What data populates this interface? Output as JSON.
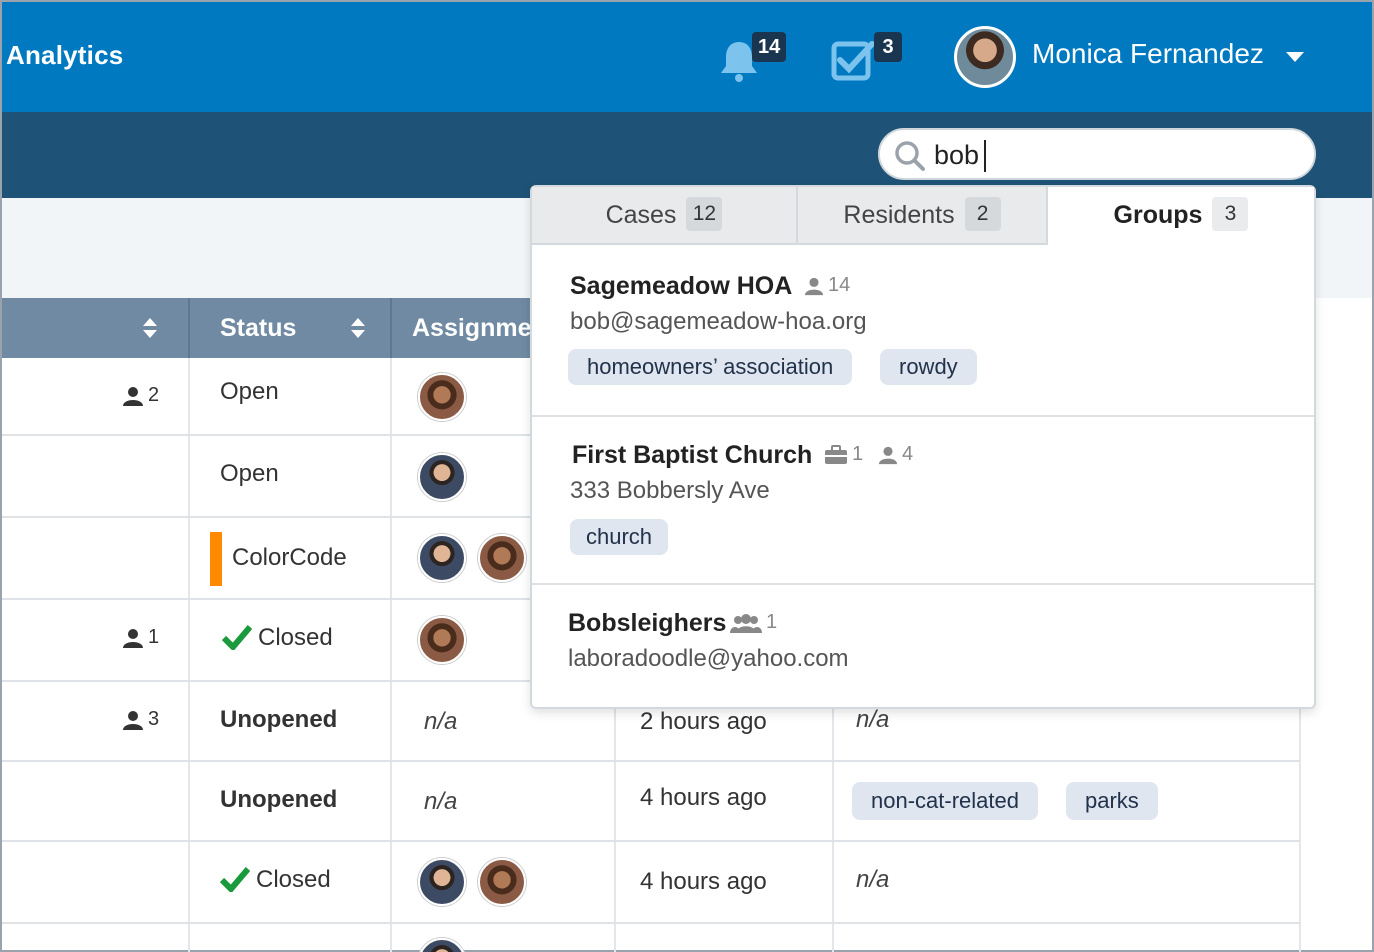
{
  "header": {
    "app_title": "Analytics",
    "notifications_count": "14",
    "tasks_count": "3",
    "user_name": "Monica Fernandez"
  },
  "search": {
    "value": "bob"
  },
  "table": {
    "columns": [
      "Status",
      "Assignment"
    ],
    "rows": [
      {
        "people": "2",
        "status": "Open"
      },
      {
        "people": "",
        "status": "Open"
      },
      {
        "people": "",
        "status": "ColorCode"
      },
      {
        "people": "1",
        "status": "Closed"
      },
      {
        "people": "3",
        "status": "Unopened",
        "assignment": "n/a",
        "updated": "2 hours ago",
        "tags_na": "n/a"
      },
      {
        "people": "",
        "status": "Unopened",
        "assignment": "n/a",
        "updated": "4 hours ago",
        "tags": [
          "non-cat-related",
          "parks"
        ]
      },
      {
        "people": "",
        "status": "Closed",
        "updated": "4 hours ago",
        "tags_na": "n/a"
      }
    ]
  },
  "dropdown": {
    "tabs": [
      {
        "label": "Cases",
        "count": "12"
      },
      {
        "label": "Residents",
        "count": "2"
      },
      {
        "label": "Groups",
        "count": "3"
      }
    ],
    "results": [
      {
        "name": "Sagemeadow HOA",
        "members": "14",
        "sub": "bob@sagemeadow-hoa.org",
        "tags": [
          "homeowners’ association",
          "rowdy"
        ]
      },
      {
        "name": "First Baptist Church",
        "cases": "1",
        "members": "4",
        "sub": "333 Bobbersly Ave",
        "tags": [
          "church"
        ]
      },
      {
        "name": "Bobsleighers",
        "groups": "1",
        "sub": "laboradoodle@yahoo.com"
      }
    ]
  },
  "colors": {
    "topbar": "#0079c1",
    "subbar": "#1e5377",
    "table_header": "#6f8aa2",
    "check_green": "#1a9a3c",
    "colorcode_orange": "#ff8a00"
  }
}
